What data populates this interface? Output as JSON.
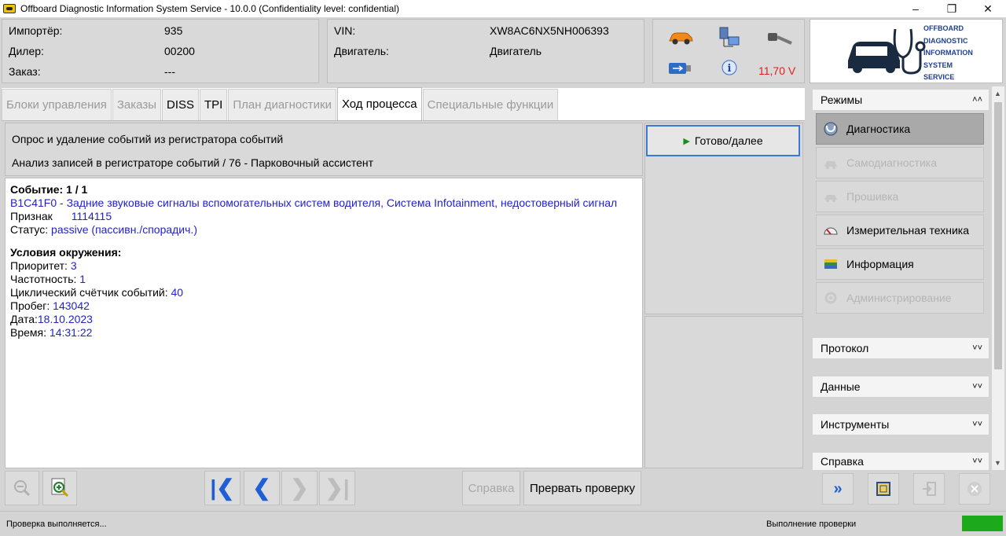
{
  "window": {
    "title": "Offboard Diagnostic Information System Service - 10.0.0 (Confidentiality level: confidential)"
  },
  "info": {
    "importer_label": "Импортёр:",
    "importer_value": "935",
    "dealer_label": "Дилер:",
    "dealer_value": "00200",
    "order_label": "Заказ:",
    "order_value": "---",
    "vin_label": "VIN:",
    "vin_value": "XW8AC6NX5NH006393",
    "engine_label": "Двигатель:",
    "engine_value": "Двигатель",
    "voltage": "11,70 V"
  },
  "logo": {
    "lines": [
      "OFFBOARD",
      "DIAGNOSTIC",
      "INFORMATION",
      "SYSTEM",
      "SERVICE"
    ]
  },
  "tabs": [
    {
      "label": "Блоки управления",
      "state": "disabled"
    },
    {
      "label": "Заказы",
      "state": "disabled"
    },
    {
      "label": "DISS",
      "state": "enabled"
    },
    {
      "label": "TPI",
      "state": "enabled"
    },
    {
      "label": "План диагностики",
      "state": "disabled"
    },
    {
      "label": "Ход процесса",
      "state": "active"
    },
    {
      "label": "Специальные функции",
      "state": "disabled"
    }
  ],
  "content": {
    "header_line1": "Опрос и удаление событий из регистратора событий",
    "header_line2": "Анализ записей в регистраторе событий / 76 - Парковочный ассистент",
    "event_title": "Событие: 1 / 1",
    "event_code_text": "B1C41F0 - Задние звуковые сигналы вспомогательных систем водителя, Система Infotainment, недостоверный сигнал",
    "sign_label": "Признак",
    "sign_value": "1114115",
    "status_label": "Статус:",
    "status_value": "passive (пассивн./спорадич.)",
    "env_title": "Условия окружения:",
    "priority_label": "Приоритет:",
    "priority_value": "3",
    "frequency_label": "Частотность:",
    "frequency_value": "1",
    "cycle_label": "Циклический счётчик событий:",
    "cycle_value": "40",
    "mileage_label": "Пробег:",
    "mileage_value": "143042",
    "date_label": "Дата:",
    "date_value": "18.10.2023",
    "time_label": "Время:",
    "time_value": "14:31:22"
  },
  "buttons": {
    "ready": "Готово/далее",
    "help": "Справка",
    "abort": "Прервать проверку"
  },
  "sidebar": {
    "modes_title": "Режимы",
    "modes": [
      {
        "label": "Диагностика",
        "state": "active",
        "icon": "stethoscope-icon"
      },
      {
        "label": "Самодиагностика",
        "state": "disabled",
        "icon": "car-diag-icon"
      },
      {
        "label": "Прошивка",
        "state": "disabled",
        "icon": "flash-icon"
      },
      {
        "label": "Измерительная техника",
        "state": "enabled",
        "icon": "gauge-icon"
      },
      {
        "label": "Информация",
        "state": "enabled",
        "icon": "books-icon"
      },
      {
        "label": "Администрирование",
        "state": "disabled",
        "icon": "gear-icon"
      }
    ],
    "sections": [
      "Протокол",
      "Данные",
      "Инструменты",
      "Справка"
    ]
  },
  "status": {
    "left": "Проверка выполняется...",
    "right": "Выполнение проверки",
    "led_color": "#1caa1c"
  }
}
